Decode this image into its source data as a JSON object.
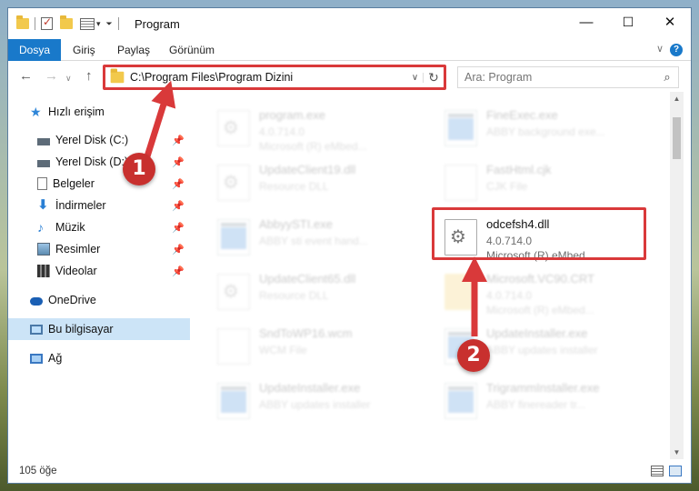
{
  "window": {
    "title": "Program"
  },
  "controls": {
    "minimize": "—",
    "maximize": "☐",
    "close": "✕"
  },
  "ribbon": {
    "tabs": [
      "Dosya",
      "Giriş",
      "Paylaş",
      "Görünüm"
    ]
  },
  "address": {
    "path": "C:\\Program Files\\Program Dizini"
  },
  "search": {
    "placeholder": "Ara: Program"
  },
  "sidebar": {
    "items": [
      {
        "label": "Hızlı erişim",
        "icon": "star-icon"
      },
      {
        "label": "Yerel Disk (C:)",
        "icon": "drive-icon"
      },
      {
        "label": "Yerel Disk (D:)",
        "icon": "drive-icon"
      },
      {
        "label": "Belgeler",
        "icon": "documents-icon"
      },
      {
        "label": "İndirmeler",
        "icon": "download-icon"
      },
      {
        "label": "Müzik",
        "icon": "music-icon"
      },
      {
        "label": "Resimler",
        "icon": "pictures-icon"
      },
      {
        "label": "Videolar",
        "icon": "video-icon"
      },
      {
        "label": "OneDrive",
        "icon": "cloud-icon"
      },
      {
        "label": "Bu bilgisayar",
        "icon": "computer-icon"
      },
      {
        "label": "Ağ",
        "icon": "network-icon"
      }
    ]
  },
  "files": [
    {
      "name": "program.exe",
      "line2": "4.0.714.0",
      "line3": "Microsoft (R) eMbed..."
    },
    {
      "name": "FineExec.exe",
      "line2": "ABBY background exe..."
    },
    {
      "name": "UpdateClient19.dll",
      "line2": "Resource DLL"
    },
    {
      "name": "FastHtml.cjk",
      "line2": "CJK File"
    },
    {
      "name": "AbbyySTI.exe",
      "line2": "ABBY sti event hand..."
    },
    {
      "name": "odcefsh4.dll",
      "line2": "4.0.714.0",
      "line3": "Microsoft (R) eMbed..."
    },
    {
      "name": "UpdateClient65.dll",
      "line2": "Resource DLL"
    },
    {
      "name": "Microsoft.VC90.CRT",
      "line2": "4.0.714.0",
      "line3": "Microsoft (R) eMbed..."
    },
    {
      "name": "SndToWP16.wcm",
      "line2": "WCM File"
    },
    {
      "name": "UpdateInstaller.exe",
      "line2": "ABBY updates installer"
    },
    {
      "name": "UpdateInstaller.exe",
      "line2": "ABBY updates installer"
    },
    {
      "name": "TrigrammInstaller.exe",
      "line2": "ABBY finereader tr..."
    }
  ],
  "status": {
    "count": "105 öğe"
  },
  "annotations": {
    "step1": "1",
    "step2": "2",
    "color": "#d9393a"
  }
}
